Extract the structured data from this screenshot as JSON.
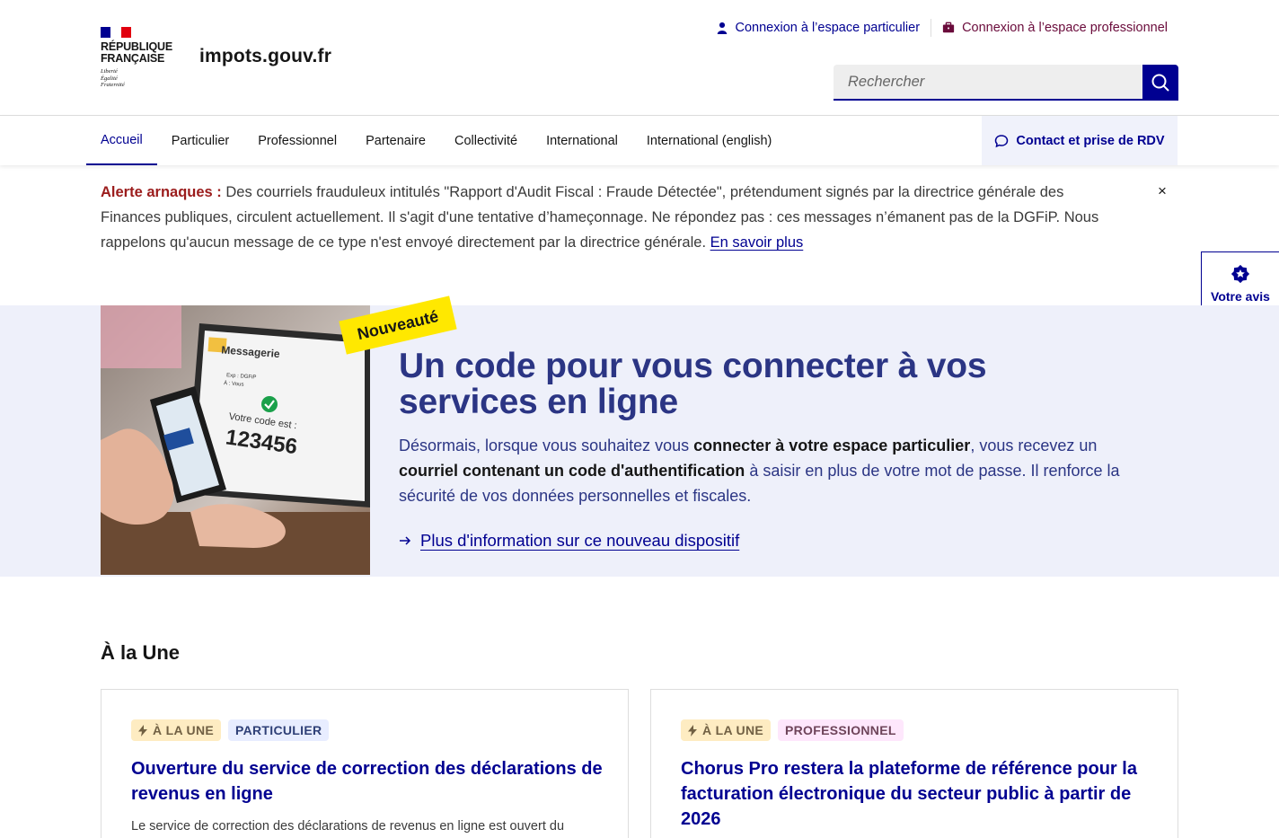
{
  "header": {
    "republic": "RÉPUBLIQUE\nFRANÇAISE",
    "motto": "Liberté\nÉgalité\nFraternité",
    "site_name": "impots.gouv.fr",
    "login_particulier": "Connexion à l’espace particulier",
    "login_professionnel": "Connexion à l’espace professionnel",
    "search_placeholder": "Rechercher"
  },
  "nav": {
    "items": [
      "Accueil",
      "Particulier",
      "Professionnel",
      "Partenaire",
      "Collectivité",
      "International",
      "International (english)"
    ],
    "contact": "Contact et prise de RDV"
  },
  "alert": {
    "title": "Alerte arnaques :",
    "body": "Des courriels frauduleux intitulés \"Rapport d'Audit Fiscal : Fraude Détectée\", prétendument signés par la directrice générale des Finances publiques, circulent actuellement. Il s'agit d'une tentative d’hameçonnage. Ne répondez pas : ces messages n’émanent pas de la DGFiP. Nous rappelons qu'aucun message de ce type n'est envoyé directement par la directrice générale. ",
    "link": "En savoir plus",
    "close": "×"
  },
  "feedback": {
    "label": "Votre avis sur le site"
  },
  "hero": {
    "badge": "Nouveauté",
    "image_text": {
      "messagerie": "Messagerie",
      "exp": "Exp : DGFiP",
      "to": "À : Vous",
      "code_label": "Votre code est :",
      "code": "123456"
    },
    "title": "Un code pour vous connecter à vos services en ligne",
    "text_1": "Désormais, lorsque vous souhaitez vous ",
    "text_bold_1": "connecter à votre espace particulier",
    "text_2": ", vous recevez un ",
    "text_bold_2": "courriel contenant un code d'authentification",
    "text_3": " à saisir en plus de votre mot de passe. Il renforce la sécurité de vos données personnelles et fiscales.",
    "link": "Plus d'information sur ce nouveau dispositif"
  },
  "une": {
    "title": "À la Une",
    "cards": [
      {
        "tag_une": "À LA UNE",
        "tag_category": "PARTICULIER",
        "title": "Ouverture du service de correction des déclarations de revenus en ligne",
        "text": "Le service de correction des déclarations de revenus en ligne est ouvert du"
      },
      {
        "tag_une": "À LA UNE",
        "tag_category": "PROFESSIONNEL",
        "title": "Chorus Pro restera la plateforme de référence pour la facturation électronique du secteur public à partir de 2026",
        "text": ""
      }
    ]
  },
  "colors": {
    "brand_blue": "#000091",
    "hero_bg": "#eef0fa",
    "hero_title": "#2b3584",
    "alert_red": "#9b1c1c",
    "badge_yellow": "#ffe800",
    "pro_purple": "#6a0b3b"
  },
  "icons": [
    "user-icon",
    "briefcase-icon",
    "search-icon",
    "chat-icon",
    "star-badge-icon",
    "arrow-right-icon",
    "lightning-icon",
    "close-icon"
  ]
}
